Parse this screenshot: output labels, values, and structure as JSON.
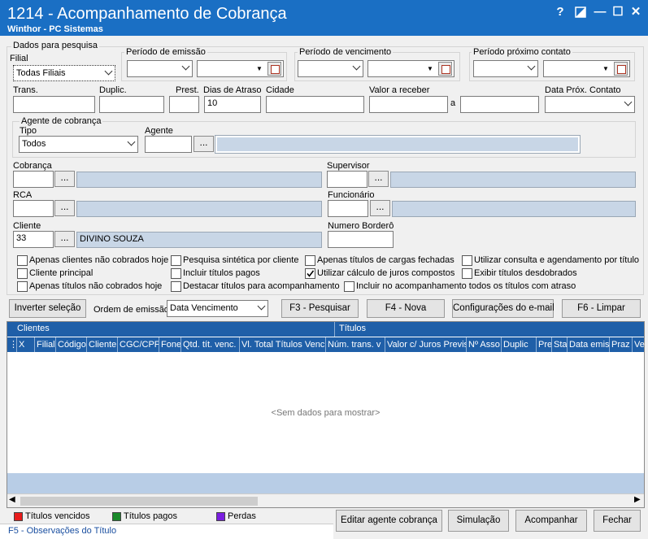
{
  "window": {
    "title": "1214 - Acompanhamento de Cobrança",
    "subtitle": "Winthor - PC Sistemas",
    "help_glyph": "?",
    "minimize_glyph": "—",
    "maximize_glyph": "☐",
    "close_glyph": "✕"
  },
  "search": {
    "section_title": "Dados para pesquisa",
    "filial_label": "Filial",
    "filial_value": "Todas Filiais",
    "emissao_label": "Período de emissão",
    "vencimento_label": "Período de vencimento",
    "proximo_contato_label": "Período próximo contato",
    "trans_label": "Trans.",
    "duplic_label": "Duplic.",
    "prest_label": "Prest.",
    "dias_atraso_label": "Dias de Atraso",
    "dias_atraso_value": "10",
    "cidade_label": "Cidade",
    "valor_receber_label": "Valor a receber",
    "valor_a_label": "a",
    "data_prox_contato_label": "Data Próx. Contato",
    "agente_group_title": "Agente de cobrança",
    "tipo_label": "Tipo",
    "tipo_value": "Todos",
    "agente_label": "Agente",
    "cobranca_label": "Cobrança",
    "supervisor_label": "Supervisor",
    "rca_label": "RCA",
    "funcionario_label": "Funcionário",
    "cliente_label": "Cliente",
    "cliente_code": "33",
    "cliente_name": "DIVINO SOUZA",
    "bordero_label": "Numero Borderô",
    "dots_label": "..."
  },
  "options": [
    {
      "label": "Apenas clientes não cobrados hoje",
      "checked": false
    },
    {
      "label": "Pesquisa sintética por cliente",
      "checked": false
    },
    {
      "label": "Apenas títulos de cargas fechadas",
      "checked": false
    },
    {
      "label": "Utilizar consulta e agendamento por título",
      "checked": false
    },
    {
      "label": "Cliente principal",
      "checked": false
    },
    {
      "label": "Incluir títulos pagos",
      "checked": false
    },
    {
      "label": "Utilizar cálculo de juros compostos",
      "checked": true
    },
    {
      "label": "Exibir títulos desdobrados",
      "checked": false
    },
    {
      "label": "Apenas títulos não cobrados hoje",
      "checked": false
    },
    {
      "label": "Destacar títulos para acompanhamento",
      "checked": false
    },
    {
      "label": "Incluir no acompanhamento todos os títulos com atraso",
      "checked": false
    }
  ],
  "toolbar": {
    "inverter_label": "Inverter seleção",
    "ordem_label": "Ordem de emissão",
    "ordem_value": "Data Vencimento",
    "pesquisar_label": "F3 - Pesquisar",
    "nova_label": "F4 - Nova",
    "config_email_label": "Configurações do e-mail",
    "limpar_label": "F6 - Limpar"
  },
  "grid": {
    "band_clientes": "Clientes",
    "band_titulos": "Títulos",
    "columns": [
      "X",
      "Filial",
      "Código",
      "Cliente",
      "CGC/CPF",
      "Fone",
      "Qtd. tít. venc.",
      "Vl. Total Títulos Venc.",
      "Núm. trans. v",
      "Valor c/ Juros Previs",
      "Nº Asso",
      "Duplic",
      "Pre",
      "Sta",
      "Data emis",
      "Praz",
      "Ve"
    ],
    "empty_text": "<Sem dados para mostrar>"
  },
  "legend": [
    {
      "label": "Títulos vencidos",
      "color": "#e81c1c"
    },
    {
      "label": "Títulos pagos",
      "color": "#1a8a2a"
    },
    {
      "label": "Perdas",
      "color": "#7a1ee0"
    }
  ],
  "footer": {
    "observacoes": "F5 - Observações do Título",
    "editar_agente_label": "Editar agente cobrança",
    "simulacao_label": "Simulação",
    "acompanhar_label": "Acompanhar",
    "fechar_label": "Fechar"
  }
}
